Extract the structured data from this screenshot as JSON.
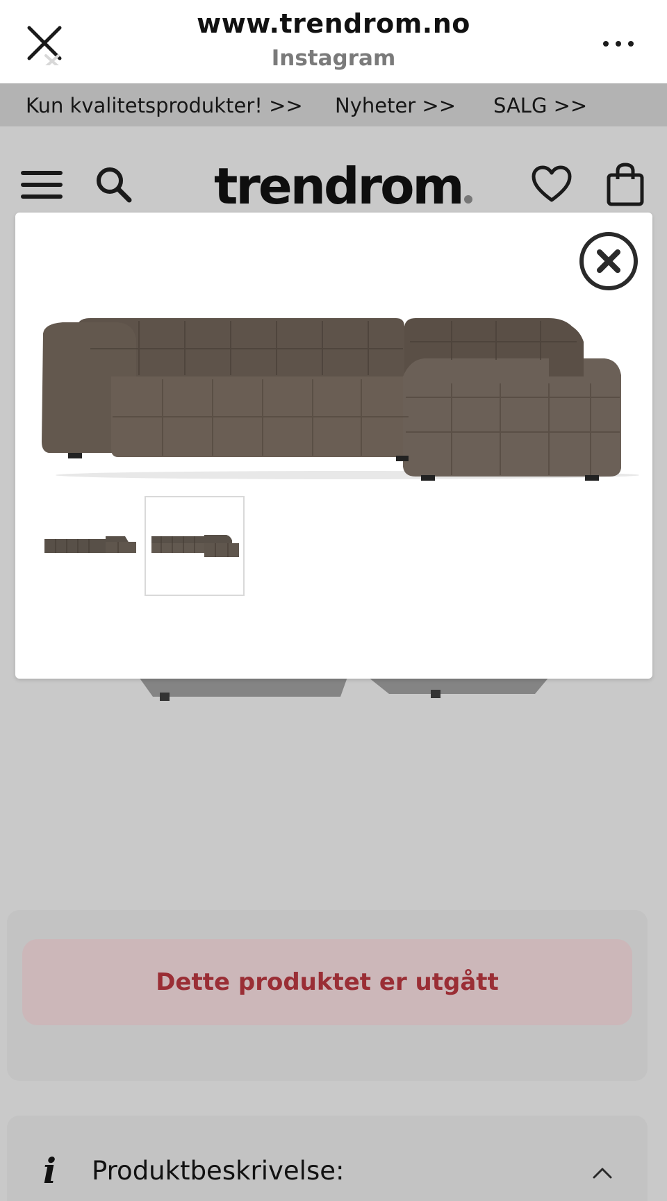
{
  "browser": {
    "url": "www.trendrom.no",
    "subtitle": "Instagram",
    "close_icon": "close-icon",
    "more_icon": "more-dots-icon"
  },
  "promo": {
    "links": [
      "Kun kvalitetsprodukter! >>",
      "Nyheter >>",
      "SALG >>"
    ]
  },
  "site_header": {
    "logo": "trendrom",
    "icons": [
      "hamburger-icon",
      "search-icon",
      "heart-icon",
      "shopping-bag-icon"
    ]
  },
  "modal": {
    "close_icon": "close-circle-icon",
    "main_image": "brown tufted corner sofa",
    "thumbnails": [
      "sofa-thumbnail-1",
      "sofa-thumbnail-2"
    ],
    "selected_thumbnail": 2
  },
  "product": {
    "status": "Dette produktet er utgått",
    "description_title": "Produktbeskrivelse:",
    "info_icon_glyph": "i"
  },
  "colors": {
    "overlay_bg": "#c9c9c9",
    "status_text": "#9a2e35",
    "status_bg": "#ccb7b9",
    "sofa": "#5c5148"
  }
}
